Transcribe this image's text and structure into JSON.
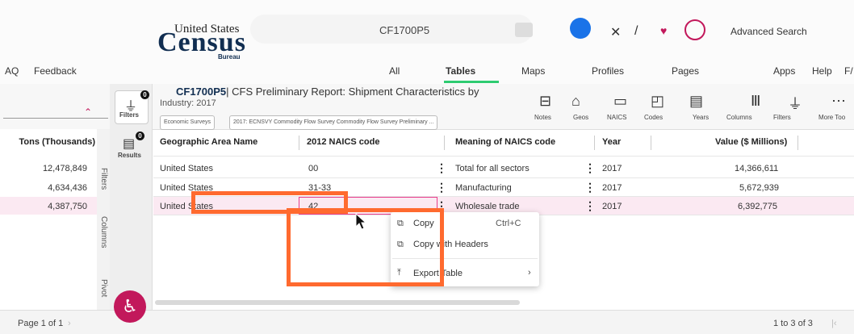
{
  "header": {
    "logo_top": "United States",
    "logo_main": "Census",
    "logo_bottom": "Bureau",
    "search_value": "CF1700P5",
    "advanced_search": "Advanced Search"
  },
  "nav": {
    "left_items": [
      "AQ",
      "Feedback"
    ],
    "tabs": [
      "All",
      "Tables",
      "Maps",
      "Profiles",
      "Pages"
    ],
    "active_tab": "Tables",
    "right_items": [
      "Apps",
      "Help",
      "F/"
    ]
  },
  "toolbar": {
    "report_id": "CF1700P5",
    "report_title": "| CFS Preliminary Report: Shipment Characteristics by",
    "report_title_line2": "Industry: 2017",
    "chips": [
      "Economic Surveys",
      "2017: ECNSVY Commodity Flow Survey Commodity Flow Survey Preliminary ..."
    ],
    "labels": [
      "Notes",
      "Geos",
      "NAICS",
      "Codes",
      "Years",
      "Columns",
      "Filters",
      "More Too"
    ]
  },
  "side": {
    "filters_label": "Filters",
    "results_label": "Results",
    "filters_badge": "0",
    "results_badge": "0",
    "vertical_tabs": [
      "Filters",
      "Columns",
      "Pivot"
    ]
  },
  "left_table": {
    "header": "Tons (Thousands)",
    "rows": [
      "12,478,849",
      "4,634,436",
      "4,387,750"
    ]
  },
  "table": {
    "headers": [
      "Geographic Area Name",
      "2012 NAICS code",
      "Meaning of NAICS code",
      "Year",
      "Value ($ Millions)"
    ],
    "rows": [
      [
        "United States",
        "00",
        "Total for all sectors",
        "2017",
        "14,366,611"
      ],
      [
        "United States",
        "31-33",
        "Manufacturing",
        "2017",
        "5,672,939"
      ],
      [
        "United States",
        "42",
        "Wholesale trade",
        "2017",
        "6,392,775"
      ]
    ]
  },
  "context_menu": {
    "items": [
      {
        "label": "Copy",
        "shortcut": "Ctrl+C",
        "icon": "copy-icon"
      },
      {
        "label": "Copy with Headers",
        "shortcut": "",
        "icon": "copy-icon"
      },
      {
        "label": "Export Table",
        "shortcut": "",
        "icon": "export-icon"
      }
    ]
  },
  "footer": {
    "page_info": "Page 1 of 1",
    "count_info": "1 to 3 of 3"
  },
  "colors": {
    "accent_green": "#2ecc71",
    "highlight_pink": "#e83e8c",
    "annotation_orange": "#ff6a2f",
    "a11y_magenta": "#c2185b",
    "census_navy": "#112e51"
  }
}
